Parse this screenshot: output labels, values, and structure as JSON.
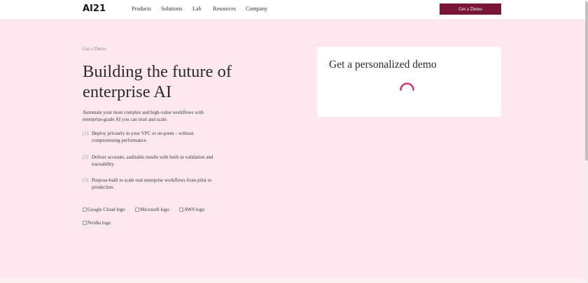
{
  "header": {
    "logo": "AI21",
    "nav": [
      {
        "label": "Products"
      },
      {
        "label": "Solutions"
      },
      {
        "label": "Lab"
      },
      {
        "label": "Resources"
      },
      {
        "label": "Company"
      }
    ],
    "cta_label": "Get a Demo"
  },
  "hero": {
    "eyebrow": "Get a Demo",
    "headline": "Building the future of enterprise AI",
    "intro": "Automate your most complex and high-value workflows with enterprise-grade AI you can trust and scale.",
    "points": [
      {
        "num": "[1]",
        "text": "Deploy privately in your VPC or on-prem – without compromising performance."
      },
      {
        "num": "[2]",
        "text": "Deliver accurate, auditable results with built-in validation and traceability."
      },
      {
        "num": "[3]",
        "text": "Purpose-built to scale real enterprise workflows from pilot to production."
      }
    ],
    "partner_logos": [
      {
        "alt": "Google Cloud logo"
      },
      {
        "alt": "Microsoft logo"
      },
      {
        "alt": "AWS logo"
      },
      {
        "alt": "Nvidia logo"
      }
    ]
  },
  "demo_panel": {
    "title": "Get a personalized demo"
  },
  "colors": {
    "page_bg": "#fce8ee",
    "accent": "#7a1535",
    "spinner": "#d6336c"
  }
}
